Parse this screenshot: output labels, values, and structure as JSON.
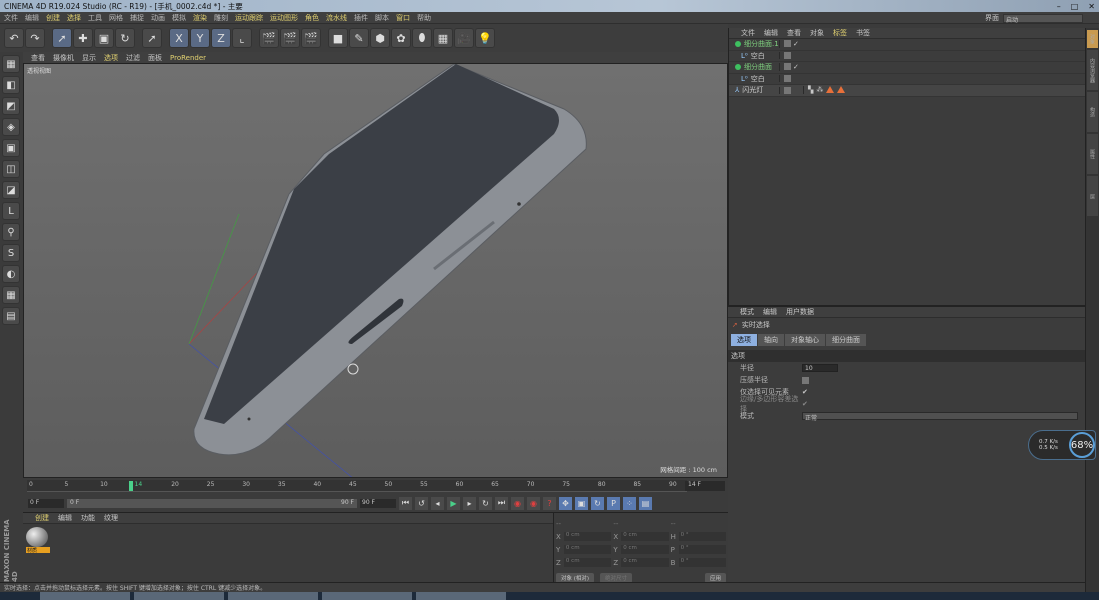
{
  "window": {
    "title": "CINEMA 4D R19.024 Studio (RC - R19) - [手机_0002.c4d *] - 主要",
    "minimize": "–",
    "maximize": "□",
    "close": "✕"
  },
  "menu": [
    {
      "label": "文件"
    },
    {
      "label": "编辑"
    },
    {
      "label": "创建"
    },
    {
      "label": "选择"
    },
    {
      "label": "工具"
    },
    {
      "label": "网格"
    },
    {
      "label": "捕捉"
    },
    {
      "label": "动画"
    },
    {
      "label": "模拟"
    },
    {
      "label": "渲染"
    },
    {
      "label": "雕刻"
    },
    {
      "label": "运动跟踪"
    },
    {
      "label": "运动图形"
    },
    {
      "label": "角色"
    },
    {
      "label": "流水线"
    },
    {
      "label": "插件"
    },
    {
      "label": "脚本"
    },
    {
      "label": "窗口"
    },
    {
      "label": "帮助"
    }
  ],
  "layout": {
    "label": "界面",
    "value": "启动"
  },
  "toolbar": [
    [
      "undo-icon",
      "↶"
    ],
    [
      "redo-icon",
      "↷"
    ],
    [
      "live-select-icon",
      "➚"
    ],
    [
      "move-icon",
      "✚"
    ],
    [
      "scale-icon",
      "▣"
    ],
    [
      "rotate-icon",
      "↻"
    ],
    [
      "last-tool-icon",
      "➚"
    ],
    [
      "x-axis-icon",
      "X"
    ],
    [
      "y-axis-icon",
      "Y"
    ],
    [
      "z-axis-icon",
      "Z"
    ],
    [
      "coordinate-system-icon",
      "⌞"
    ],
    [
      "render-view-icon",
      "🎬"
    ],
    [
      "render-picture-viewer-icon",
      "🎬"
    ],
    [
      "render-settings-icon",
      "🎬"
    ],
    [
      "cube-icon",
      "■"
    ],
    [
      "pen-icon",
      "✎"
    ],
    [
      "subdivision-icon",
      "⬢"
    ],
    [
      "array-icon",
      "✿"
    ],
    [
      "deformer-icon",
      "⬮"
    ],
    [
      "floor-icon",
      "▦"
    ],
    [
      "camera-icon",
      "🎥"
    ],
    [
      "light-icon",
      "💡"
    ]
  ],
  "left_tools": [
    [
      "make-editable-icon",
      "▦"
    ],
    [
      "model-mode-icon",
      "◧"
    ],
    [
      "texture-mode-icon",
      "◩"
    ],
    [
      "workplane-icon",
      "◈"
    ],
    [
      "points-mode-icon",
      "▣"
    ],
    [
      "edges-mode-icon",
      "◫"
    ],
    [
      "polygons-mode-icon",
      "◪"
    ],
    [
      "axis-icon",
      "L"
    ],
    [
      "tweak-icon",
      "⚲"
    ],
    [
      "snap-icon",
      "S"
    ],
    [
      "magnet-icon",
      "◐"
    ],
    [
      "grid-icon",
      "▦"
    ],
    [
      "lock-icon",
      "▤"
    ]
  ],
  "viewport": {
    "menu": [
      {
        "label": "查看"
      },
      {
        "label": "摄像机"
      },
      {
        "label": "显示"
      },
      {
        "label": "选项"
      },
      {
        "label": "过滤"
      },
      {
        "label": "面板"
      },
      {
        "label": "ProRender"
      }
    ],
    "label": "透视视图",
    "grid_info": "网格间距 : 100 cm"
  },
  "object_manager": {
    "menu": [
      {
        "label": "文件"
      },
      {
        "label": "编辑"
      },
      {
        "label": "查看"
      },
      {
        "label": "对象"
      },
      {
        "label": "标签"
      },
      {
        "label": "书签"
      }
    ],
    "objects": [
      {
        "name": "细分曲面.1",
        "icon": "subdivision-icon",
        "tags": "✓"
      },
      {
        "name": "空白",
        "icon": "null-icon",
        "tags": ""
      },
      {
        "name": "细分曲面",
        "icon": "subdivision-icon",
        "tags": "✓"
      },
      {
        "name": "空白",
        "icon": "null-icon",
        "tags": ""
      },
      {
        "name": "闪光灯",
        "icon": "light-object-icon",
        "tags": "tags"
      }
    ]
  },
  "attributes": {
    "menu": [
      {
        "label": "模式"
      },
      {
        "label": "编辑"
      },
      {
        "label": "用户数据"
      }
    ],
    "tool_name": "实时选择",
    "tabs": [
      {
        "label": "选项"
      },
      {
        "label": "轴向"
      },
      {
        "label": "对象轴心"
      },
      {
        "label": "细分曲面"
      }
    ],
    "section": "选项",
    "radius_label": "半径",
    "radius": "10",
    "pressure_label": "压感半径",
    "pressure": false,
    "visible_only_label": "仅选择可见元素",
    "visible_only": true,
    "edge_poly_label": "边缘/多边形容差选择",
    "edge_poly": true,
    "mode_label": "模式",
    "mode": "正常"
  },
  "right_tabs": [
    {
      "label": "对象"
    },
    {
      "label": "内容浏览器"
    },
    {
      "label": "构造"
    },
    {
      "label": "属性"
    },
    {
      "label": "层"
    }
  ],
  "hud": {
    "up": "0.7 K/s",
    "down": "0.5 K/s",
    "percent": "68%"
  },
  "timeline": {
    "ticks": [
      "0",
      "5",
      "10",
      "14",
      "20",
      "25",
      "30",
      "35",
      "40",
      "45",
      "50",
      "55",
      "60",
      "65",
      "70",
      "75",
      "80",
      "85",
      "90"
    ],
    "current_frame": 14,
    "current_label": "14 F",
    "start": "0 F",
    "scrub_start": "0 F",
    "scrub_end": "90 F",
    "end": "90 F"
  },
  "material_manager": {
    "menu": [
      {
        "label": "创建"
      },
      {
        "label": "编辑"
      },
      {
        "label": "功能"
      },
      {
        "label": "纹理"
      }
    ],
    "material": "材质"
  },
  "brand": "MAXON CINEMA 4D",
  "coordinates": {
    "headers": [
      "--",
      "--",
      "--"
    ],
    "rows": [
      [
        "X",
        "0 cm",
        "X",
        "0 cm",
        "H",
        "0 °"
      ],
      [
        "Y",
        "0 cm",
        "Y",
        "0 cm",
        "P",
        "0 °"
      ],
      [
        "Z",
        "0 cm",
        "Z",
        "0 cm",
        "B",
        "0 °"
      ]
    ],
    "mode": "对象 (相对)",
    "size_mode": "绝对尺寸",
    "apply": "应用"
  },
  "status": "实时选择：点击并拖动鼠标选择元素。按住 SHIFT 键增加选择对象；按住 CTRL 键减少选择对象。"
}
